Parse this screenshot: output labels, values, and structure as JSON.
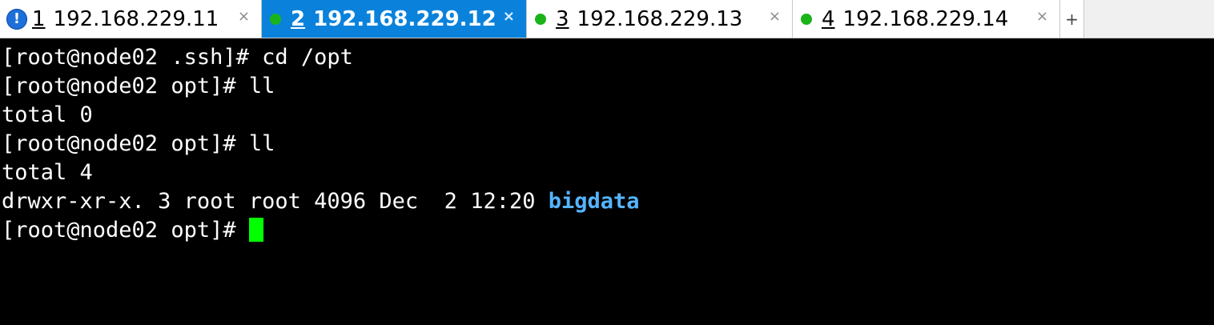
{
  "tabs": [
    {
      "number": "1",
      "title": "192.168.229.11",
      "status": "alert",
      "status_glyph": "!",
      "close": "×"
    },
    {
      "number": "2",
      "title": "192.168.229.12",
      "status": "connected",
      "close": "×"
    },
    {
      "number": "3",
      "title": "192.168.229.13",
      "status": "connected",
      "close": "×"
    },
    {
      "number": "4",
      "title": "192.168.229.14",
      "status": "connected",
      "close": "×"
    }
  ],
  "new_tab_label": "+",
  "colors": {
    "active_tab": "#0a82dc",
    "connected": "#1ab41a",
    "alert": "#1e6fd9",
    "directory": "#55b4ff",
    "cursor": "#00ff00"
  },
  "terminal": {
    "lines": [
      "[root@node02 .ssh]# cd /opt",
      "[root@node02 opt]# ll",
      "total 0",
      "[root@node02 opt]# ll",
      "total 4"
    ],
    "listing": {
      "prefix": "drwxr-xr-x. 3 root root 4096 Dec  2 12:20 ",
      "dirname": "bigdata"
    },
    "prompt": "[root@node02 opt]# "
  }
}
